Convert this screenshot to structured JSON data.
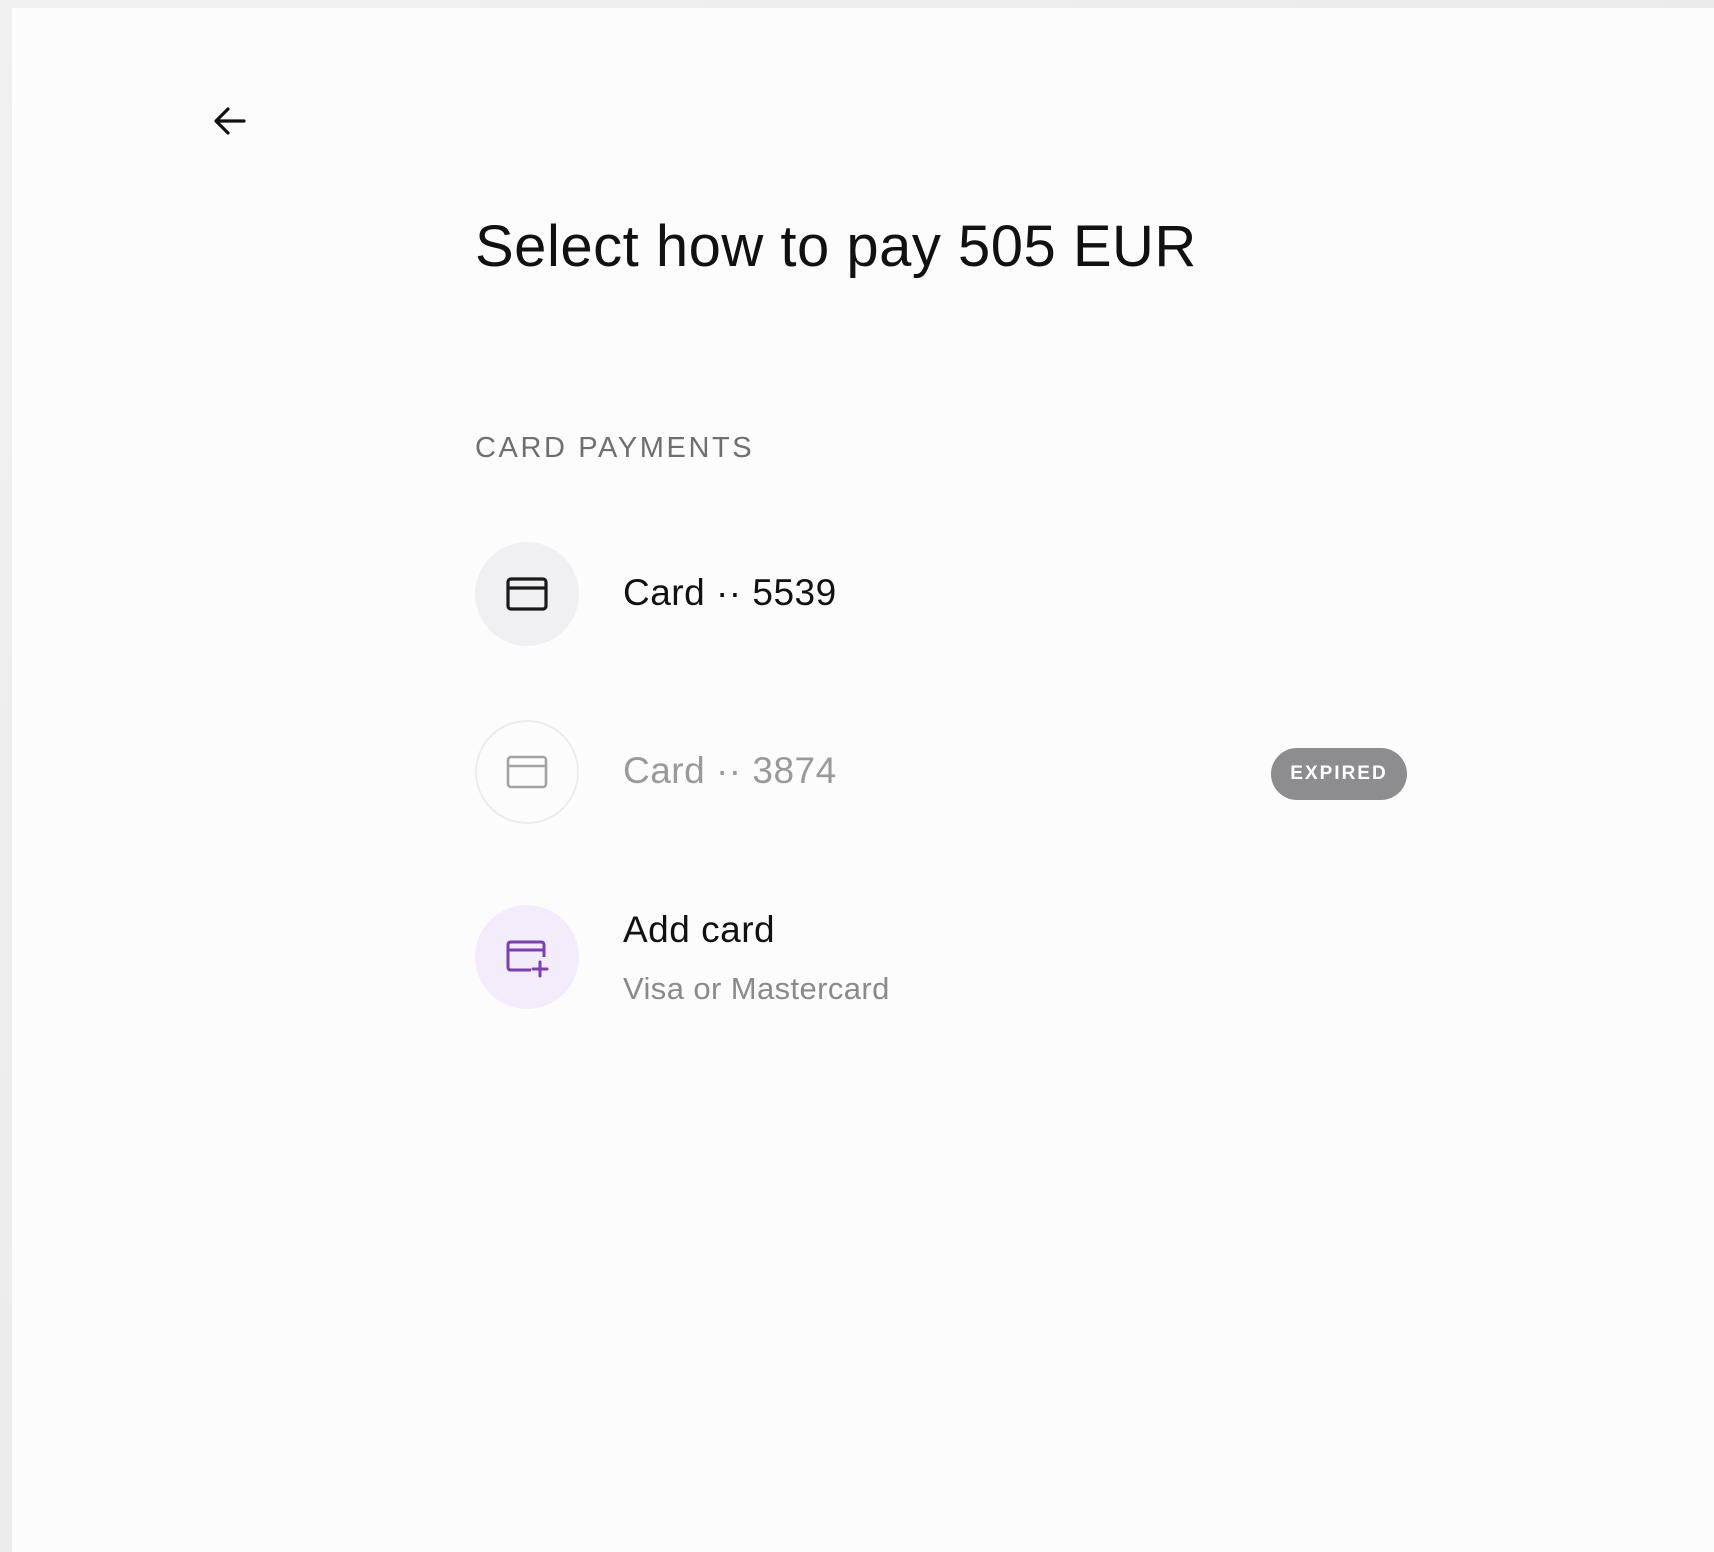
{
  "header": {
    "back_icon": "arrow-left-icon"
  },
  "title": "Select how to pay 505 EUR",
  "section_label": "CARD PAYMENTS",
  "options": [
    {
      "label": "Card ·· 5539",
      "icon": "credit-card-icon",
      "state": "active"
    },
    {
      "label": "Card ·· 3874",
      "icon": "credit-card-icon",
      "state": "expired",
      "badge": "EXPIRED"
    },
    {
      "label": "Add card",
      "sublabel": "Visa or Mastercard",
      "icon": "add-card-icon"
    }
  ],
  "colors": {
    "accent": "#7b3fb5",
    "accent_background": "#f3ecfb",
    "badge_background": "#8d8d8f"
  }
}
